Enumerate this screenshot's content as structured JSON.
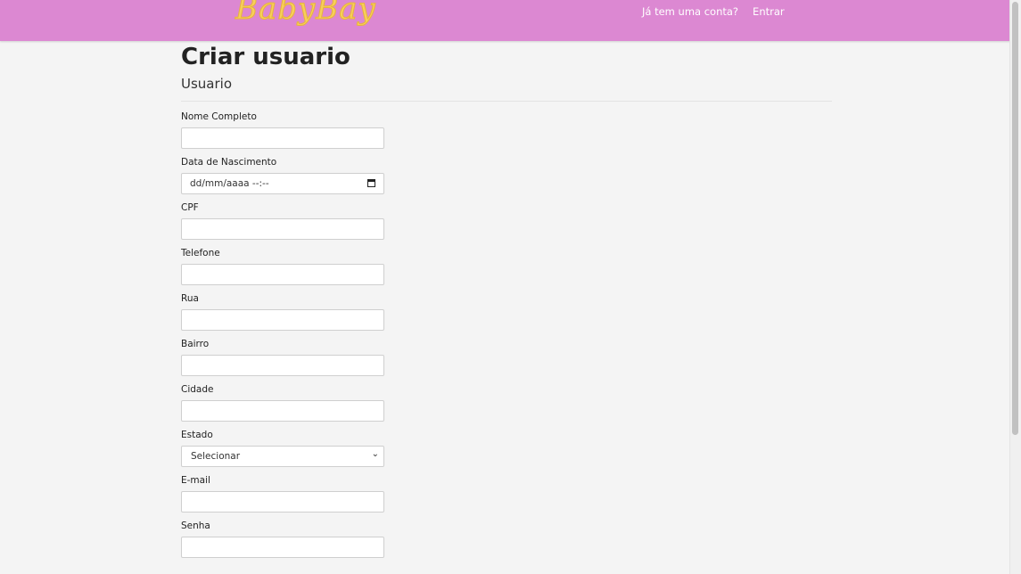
{
  "header": {
    "logo_text": "BabyBay",
    "nav": {
      "account_question": "Já tem uma conta?",
      "login_link": "Entrar"
    }
  },
  "page": {
    "title": "Criar usuario",
    "subtitle": "Usuario"
  },
  "form": {
    "fields": [
      {
        "label": "Nome Completo",
        "type": "text",
        "value": ""
      },
      {
        "label": "Data de Nascimento",
        "type": "datetime",
        "placeholder": "dd/mm/aaaa --:--"
      },
      {
        "label": "CPF",
        "type": "text",
        "value": ""
      },
      {
        "label": "Telefone",
        "type": "text",
        "value": ""
      },
      {
        "label": "Rua",
        "type": "text",
        "value": ""
      },
      {
        "label": "Bairro",
        "type": "text",
        "value": ""
      },
      {
        "label": "Cidade",
        "type": "text",
        "value": ""
      },
      {
        "label": "Estado",
        "type": "select",
        "selected": "Selecionar"
      },
      {
        "label": "E-mail",
        "type": "text",
        "value": ""
      },
      {
        "label": "Senha",
        "type": "password",
        "value": ""
      }
    ]
  },
  "colors": {
    "header_bg": "#dc88d2",
    "logo": "#f7cf5a",
    "page_bg": "#f4f4f4"
  }
}
